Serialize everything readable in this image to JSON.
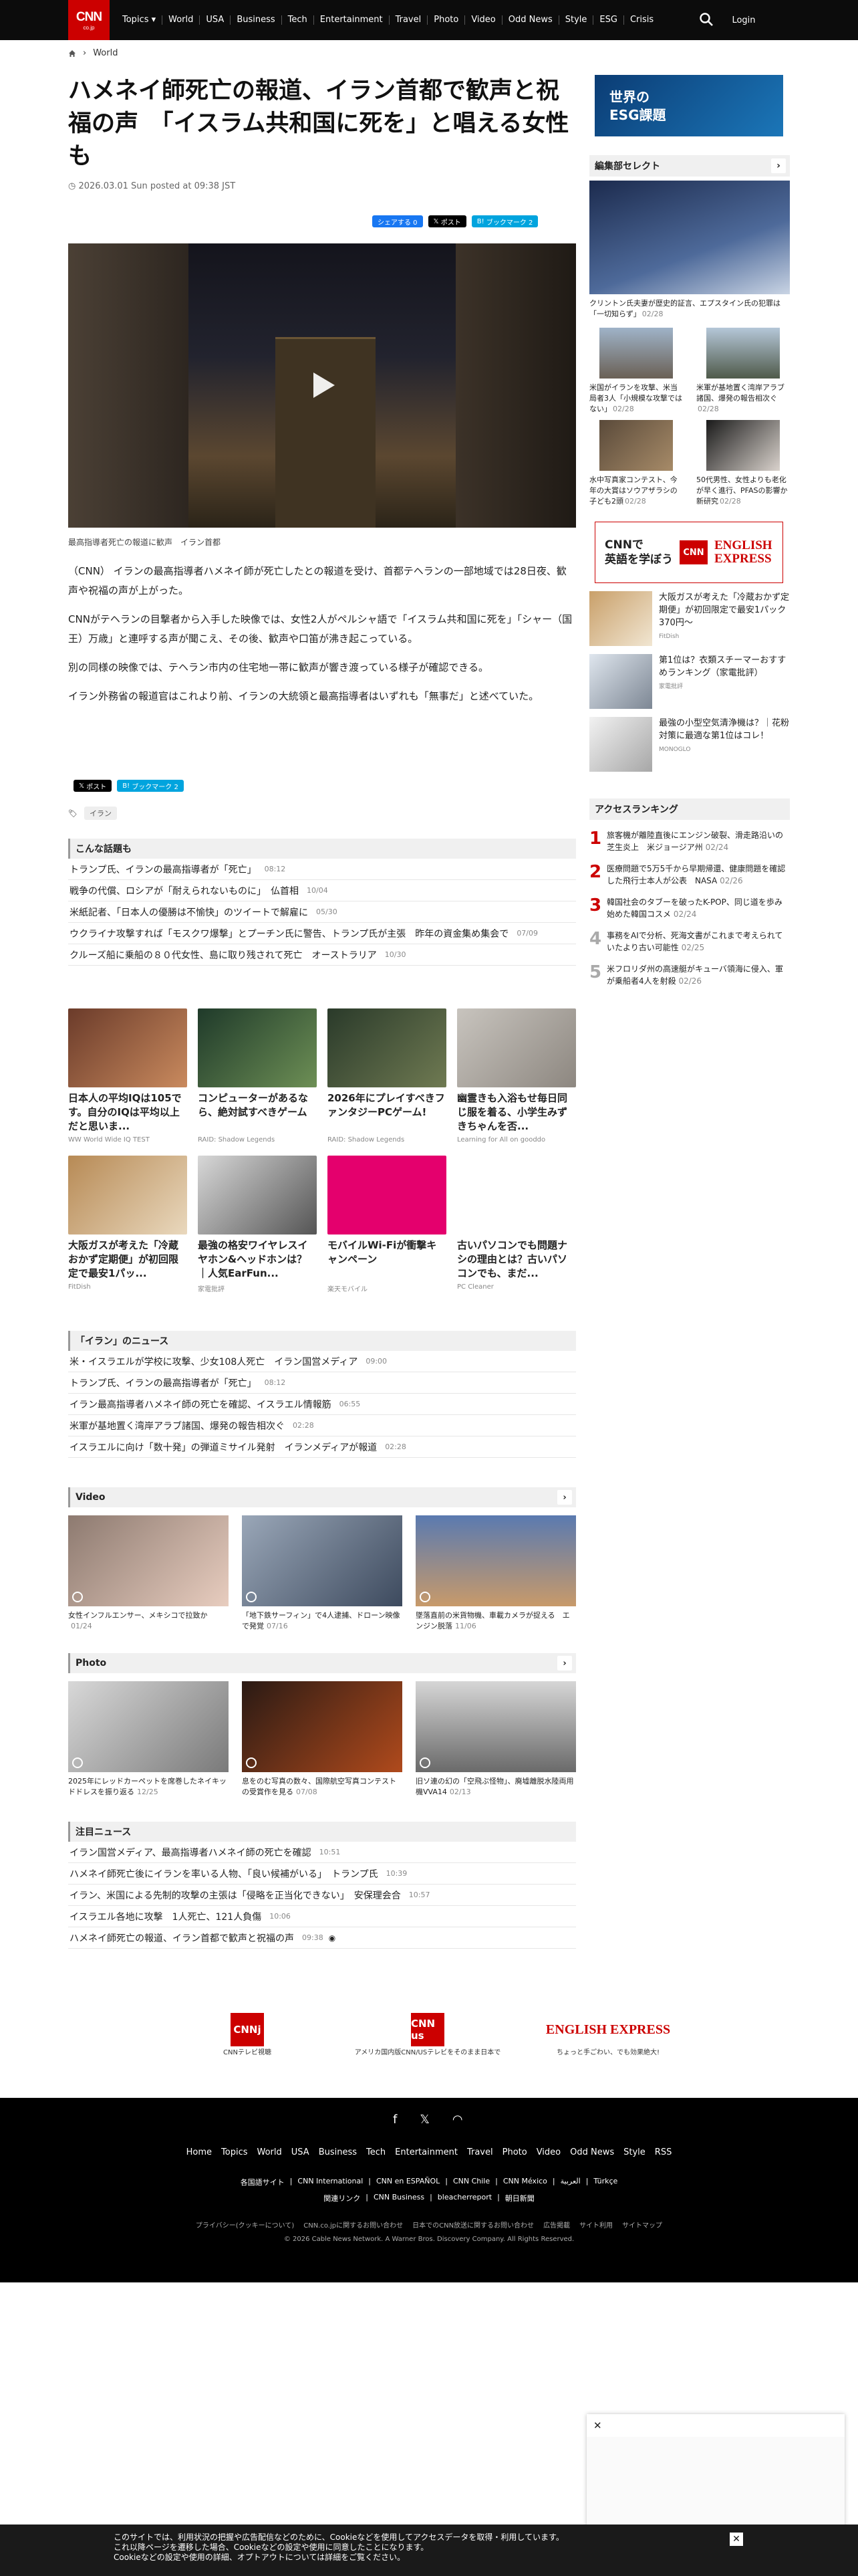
{
  "header": {
    "logo": "CNN",
    "logo_sub": "co.jp",
    "nav": [
      "Topics ▾",
      "World",
      "USA",
      "Business",
      "Tech",
      "Entertainment",
      "Travel",
      "Photo",
      "Video",
      "Odd News",
      "Style",
      "ESG",
      "Crisis"
    ],
    "login": "Login"
  },
  "breadcrumb": {
    "home_icon": "home-icon",
    "item": "World"
  },
  "article": {
    "title": "ハメネイ師死亡の報道、イラン首都で歓声と祝福の声　「イスラム共和国に死を」と唱える女性も",
    "date": "2026.03.01 Sun posted at 09:38 JST",
    "share": {
      "facebook": "シェアする 0",
      "x": "ポスト",
      "hatena": "ブックマーク 2"
    },
    "caption": "最高指導者死亡の報道に歓声　イラン首都",
    "paragraphs": [
      "（CNN） イランの最高指導者ハメネイ師が死亡したとの報道を受け、首都テヘランの一部地域では28日夜、歓声や祝福の声が上がった。",
      "CNNがテヘランの目撃者から入手した映像では、女性2人がペルシャ語で「イスラム共和国に死を」「シャー（国王）万歳」と連呼する声が聞こえ、その後、歓声や口笛が沸き起こっている。",
      "別の同様の映像では、テヘラン市内の住宅地一帯に歓声が響き渡っている様子が確認できる。",
      "イラン外務省の報道官はこれより前、イランの大統領と最高指導者はいずれも「無事だ」と述べていた。"
    ],
    "share2": {
      "x": "ポスト",
      "hatena": "ブックマーク 2"
    },
    "tag": "イラン"
  },
  "kondan": {
    "title": "こんな話題も",
    "items": [
      {
        "t": "トランプ氏、イランの最高指導者が「死亡」",
        "d": "08:12"
      },
      {
        "t": "戦争の代償、ロシアが「耐えられないものに」　仏首相",
        "d": "10/04"
      },
      {
        "t": "米紙記者、「日本人の優勝は不愉快」のツイートで解雇に",
        "d": "05/30"
      },
      {
        "t": "ウクライナ攻撃すれば「モスクワ爆撃」とプーチン氏に警告、トランプ氏が主張　昨年の資金集め集会で",
        "d": "07/09"
      },
      {
        "t": "クルーズ船に乗船の８０代女性、島に取り残されて死亡　オーストラリア",
        "d": "10/30"
      }
    ]
  },
  "ads": [
    {
      "t": "日本人の平均IQは105です。自分のIQは平均以上だと思いま...",
      "s": "WW World Wide IQ TEST"
    },
    {
      "t": "コンピューターがあるなら、絶対試すべきゲーム",
      "s": "RAID: Shadow Legends"
    },
    {
      "t": "2026年にプレイすべきファンタジーPCゲーム!",
      "s": "RAID: Shadow Legends"
    },
    {
      "t": "幽霊きも入浴もせ毎日同じ服を着る、小学生みずきちゃんを否...",
      "s": "Learning for All on gooddo"
    },
    {
      "t": "大阪ガスが考えた「冷蔵おかず定期便」が初回限定で最安1パッ...",
      "s": "FitDish"
    },
    {
      "t": "最強の格安ワイヤレスイヤホン&ヘッドホンは？｜人気EarFun...",
      "s": "家電批評"
    },
    {
      "t": "モバイルWi-Fiが衝撃キャンペーン",
      "s": "楽天モバイル"
    },
    {
      "t": "古いパソコンでも問題ナシの理由とは？古いパソコンでも、まだ...",
      "s": "PC Cleaner"
    }
  ],
  "iran_news": {
    "title": "「イラン」のニュース",
    "items": [
      {
        "t": "米・イスラエルが学校に攻撃、少女108人死亡　イラン国営メディア",
        "d": "09:00"
      },
      {
        "t": "トランプ氏、イランの最高指導者が「死亡」",
        "d": "08:12"
      },
      {
        "t": "イラン最高指導者ハメネイ師の死亡を確認、イスラエル情報筋",
        "d": "06:55"
      },
      {
        "t": "米軍が基地置く湾岸アラブ諸国、爆発の報告相次ぐ",
        "d": "02:28"
      },
      {
        "t": "イスラエルに向け「数十発」の弾道ミサイル発射　イランメディアが報道",
        "d": "02:28"
      }
    ]
  },
  "video": {
    "title": "Video",
    "items": [
      {
        "t": "女性インフルエンサー、メキシコで拉致か",
        "d": "01/24"
      },
      {
        "t": "「地下鉄サーフィン」で4人逮捕、ドローン映像で発覚",
        "d": "07/16"
      },
      {
        "t": "墜落直前の米貨物機、車載カメラが捉える　エンジン脱落",
        "d": "11/06"
      }
    ]
  },
  "photo": {
    "title": "Photo",
    "items": [
      {
        "t": "2025年にレッドカーペットを席巻したネイキッドドレスを振り返る",
        "d": "12/25"
      },
      {
        "t": "息をのむ写真の数々、国際航空写真コンテストの受賞作を見る",
        "d": "07/08"
      },
      {
        "t": "旧ソ連の幻の「空飛ぶ怪物」、廃墟離脱水陸両用機VVA14",
        "d": "02/13"
      }
    ]
  },
  "chumoku": {
    "title": "注目ニュース",
    "items": [
      {
        "t": "イラン国営メディア、最高指導者ハメネイ師の死亡を確認",
        "d": "10:51"
      },
      {
        "t": "ハメネイ師死亡後にイランを率いる人物、「良い候補がいる」　トランプ氏",
        "d": "10:39"
      },
      {
        "t": "イラン、米国による先制的攻撃の主張は「侵略を正当化できない」　安保理会合",
        "d": "10:57"
      },
      {
        "t": "イスラエル各地に攻撃　1人死亡、121人負傷",
        "d": "10:06"
      },
      {
        "t": "ハメネイ師死亡の報道、イラン首都で歓声と祝福の声",
        "d": "09:38"
      }
    ]
  },
  "sidebar": {
    "esg": "世界の\nESG課題",
    "editor_title": "編集部セレクト",
    "top": {
      "t": "クリントン氏夫妻が歴史的証言、エプスタイン氏の犯罪は「一切知らず」",
      "d": "02/28"
    },
    "pairs": [
      {
        "t": "米国がイランを攻撃、米当局者3人「小規模な攻撃ではない」",
        "d": "02/28"
      },
      {
        "t": "米軍が基地置く湾岸アラブ諸国、爆発の報告相次ぐ",
        "d": "02/28"
      },
      {
        "t": "水中写真家コンテスト、今年の大賞はソウアザラシの子ども2頭",
        "d": "02/28"
      },
      {
        "t": "50代男性、女性よりも老化が早く進行、PFASの影響か　新研究",
        "d": "02/28"
      }
    ],
    "english": {
      "jp": "CNNで\n英語を学ぼう",
      "logo": "CNN",
      "ex": "ENGLISH\nEXPRESS"
    },
    "ads": [
      {
        "t": "大阪ガスが考えた「冷蔵おかず定期便」が初回限定で最安1パック370円〜",
        "s": "FitDish"
      },
      {
        "t": "第1位は？衣類スチーマーおすすめランキング（家電批評）",
        "s": "家電批評"
      },
      {
        "t": "最強の小型空気清浄機は？｜花粉対策に最適な第1位はコレ！",
        "s": "MONOGLO"
      }
    ],
    "ranking_title": "アクセスランキング",
    "ranking": [
      {
        "t": "旅客機が離陸直後にエンジン破裂、滑走路沿いの芝生炎上　米ジョージア州",
        "d": "02/24"
      },
      {
        "t": "医療問題で5万5千から早期帰還、健康問題を確認した飛行士本人が公表　NASA",
        "d": "02/26"
      },
      {
        "t": "韓国社会のタブーを破ったK-POP、同じ道を歩み始めた韓国コスメ",
        "d": "02/24"
      },
      {
        "t": "事務をAIで分析、死海文書がこれまで考えられていたより古い可能性",
        "d": "02/25"
      },
      {
        "t": "米フロリダ州の高速艇がキューバ領海に侵入、軍が乗船者4人を射殺",
        "d": "02/26"
      }
    ]
  },
  "footer_ads": [
    {
      "logo": "CNNj",
      "t": "CNNテレビ視聴"
    },
    {
      "logo": "CNN us",
      "t": "アメリカ国内版CNN/USテレビをそのまま日本で"
    },
    {
      "logo": "ENGLISH EXPRESS",
      "t": "ちょっと手ごわい、でも効果絶大!"
    }
  ],
  "footer": {
    "nav": [
      "Home",
      "Topics",
      "World",
      "USA",
      "Business",
      "Tech",
      "Entertainment",
      "Travel",
      "Photo",
      "Video",
      "Odd News",
      "Style",
      "RSS"
    ],
    "links": [
      "各国語サイト",
      "CNN International",
      "CNN en ESPAÑOL",
      "CNN Chile",
      "CNN México",
      "العربية",
      "Türkçe"
    ],
    "links2": [
      "関連リンク",
      "CNN Business",
      "bleacherreport",
      "朝日新聞"
    ],
    "small": [
      "プライバシー(クッキーについて)",
      "CNN.co.jpに関するお問い合わせ",
      "日本でのCNN放送に関するお問い合わせ",
      "広告掲載",
      "サイト利用",
      "サイトマップ"
    ],
    "copyright": "© 2026 Cable News Network. A Warner Bros. Discovery Company. All Rights Reserved."
  },
  "cookie": "このサイトでは、利用状況の把握や広告配信などのために、Cookieなどを使用してアクセスデータを取得・利用しています。\nこれ以降ページを遷移した場合、Cookieなどの設定や使用に同意したことになります。\nCookieなどの設定や使用の詳細、オプトアウトについては詳細をご覧ください。",
  "colors": {
    "brand": "#cc0000",
    "header": "#0c0c0c",
    "facebook": "#1877f2",
    "hatena": "#00a4de"
  }
}
